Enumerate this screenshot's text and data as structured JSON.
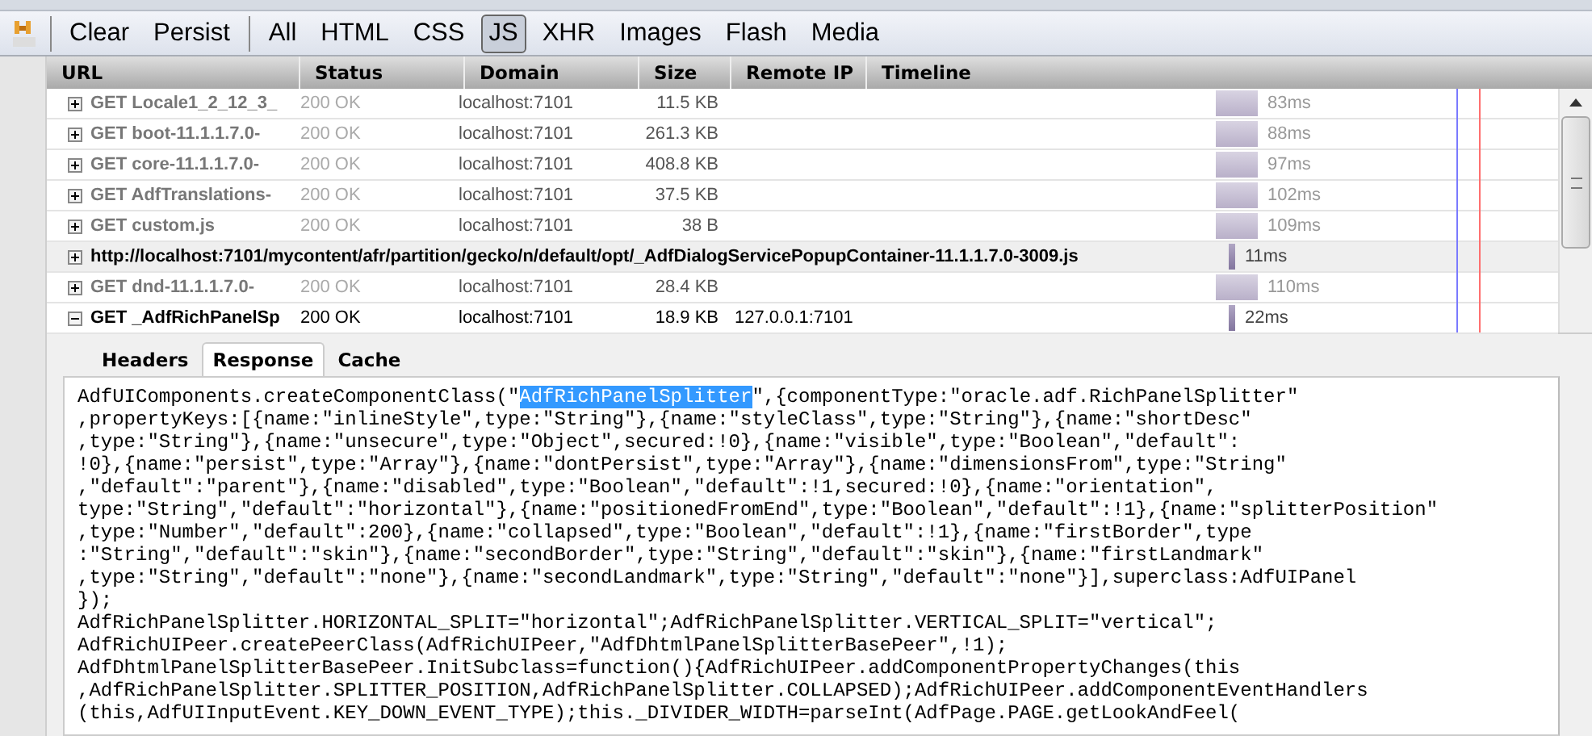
{
  "toolbar": {
    "actions": [
      "Clear",
      "Persist"
    ],
    "filters": [
      {
        "label": "All",
        "selected": false
      },
      {
        "label": "HTML",
        "selected": false
      },
      {
        "label": "CSS",
        "selected": false
      },
      {
        "label": "JS",
        "selected": true
      },
      {
        "label": "XHR",
        "selected": false
      },
      {
        "label": "Images",
        "selected": false
      },
      {
        "label": "Flash",
        "selected": false
      },
      {
        "label": "Media",
        "selected": false
      }
    ]
  },
  "table": {
    "columns": [
      "URL",
      "Status",
      "Domain",
      "Size",
      "Remote IP",
      "Timeline"
    ],
    "rows": [
      {
        "kind": "request",
        "expanded": false,
        "cached": true,
        "url": "GET Locale1_2_12_3_",
        "status": "200 OK",
        "domain": "localhost:7101",
        "size": "11.5 KB",
        "time": "83ms"
      },
      {
        "kind": "request",
        "expanded": false,
        "cached": true,
        "url": "GET boot-11.1.1.7.0-",
        "status": "200 OK",
        "domain": "localhost:7101",
        "size": "261.3 KB",
        "time": "88ms"
      },
      {
        "kind": "request",
        "expanded": false,
        "cached": true,
        "url": "GET core-11.1.1.7.0-",
        "status": "200 OK",
        "domain": "localhost:7101",
        "size": "408.8 KB",
        "time": "97ms"
      },
      {
        "kind": "request",
        "expanded": false,
        "cached": true,
        "url": "GET AdfTranslations-",
        "status": "200 OK",
        "domain": "localhost:7101",
        "size": "37.5 KB",
        "time": "102ms"
      },
      {
        "kind": "request",
        "expanded": false,
        "cached": true,
        "url": "GET custom.js",
        "status": "200 OK",
        "domain": "localhost:7101",
        "size": "38 B",
        "time": "109ms"
      },
      {
        "kind": "url",
        "expanded": false,
        "cached": false,
        "url": "http://localhost:7101/mycontent/afr/partition/gecko/n/default/opt/_AdfDialogServicePopupContainer-11.1.1.7.0-3009.js",
        "time": "11ms"
      },
      {
        "kind": "request",
        "expanded": false,
        "cached": true,
        "url": "GET dnd-11.1.1.7.0-",
        "status": "200 OK",
        "domain": "localhost:7101",
        "size": "28.4 KB",
        "time": "110ms"
      },
      {
        "kind": "request",
        "expanded": true,
        "cached": false,
        "url": "GET _AdfRichPanelSp",
        "status": "200 OK",
        "domain": "localhost:7101",
        "size": "18.9 KB",
        "remote_ip": "127.0.0.1:7101",
        "time": "22ms"
      }
    ]
  },
  "detail": {
    "tabs": [
      {
        "label": "Headers",
        "selected": false
      },
      {
        "label": "Response",
        "selected": true
      },
      {
        "label": "Cache",
        "selected": false
      }
    ],
    "lines": [
      {
        "segments": [
          {
            "text": "AdfUIComponents.createComponentClass(\"",
            "selected": false
          },
          {
            "text": "AdfRichPanelSplitter",
            "selected": true
          },
          {
            "text": "\",{componentType:\"oracle.adf.RichPanelSplitter\"",
            "selected": false
          }
        ]
      },
      {
        "segments": [
          {
            "text": ",propertyKeys:[{name:\"inlineStyle\",type:\"String\"},{name:\"styleClass\",type:\"String\"},{name:\"shortDesc\"",
            "selected": false
          }
        ]
      },
      {
        "segments": [
          {
            "text": ",type:\"String\"},{name:\"unsecure\",type:\"Object\",secured:!0},{name:\"visible\",type:\"Boolean\",\"default\":",
            "selected": false
          }
        ]
      },
      {
        "segments": [
          {
            "text": "!0},{name:\"persist\",type:\"Array\"},{name:\"dontPersist\",type:\"Array\"},{name:\"dimensionsFrom\",type:\"String\"",
            "selected": false
          }
        ]
      },
      {
        "segments": [
          {
            "text": ",\"default\":\"parent\"},{name:\"disabled\",type:\"Boolean\",\"default\":!1,secured:!0},{name:\"orientation\",",
            "selected": false
          }
        ]
      },
      {
        "segments": [
          {
            "text": "type:\"String\",\"default\":\"horizontal\"},{name:\"positionedFromEnd\",type:\"Boolean\",\"default\":!1},{name:\"splitterPosition\"",
            "selected": false
          }
        ]
      },
      {
        "segments": [
          {
            "text": ",type:\"Number\",\"default\":200},{name:\"collapsed\",type:\"Boolean\",\"default\":!1},{name:\"firstBorder\",type",
            "selected": false
          }
        ]
      },
      {
        "segments": [
          {
            "text": ":\"String\",\"default\":\"skin\"},{name:\"secondBorder\",type:\"String\",\"default\":\"skin\"},{name:\"firstLandmark\"",
            "selected": false
          }
        ]
      },
      {
        "segments": [
          {
            "text": ",type:\"String\",\"default\":\"none\"},{name:\"secondLandmark\",type:\"String\",\"default\":\"none\"}],superclass:AdfUIPanel",
            "selected": false
          }
        ]
      },
      {
        "segments": [
          {
            "text": "});",
            "selected": false
          }
        ]
      },
      {
        "segments": [
          {
            "text": "AdfRichPanelSplitter.HORIZONTAL_SPLIT=\"horizontal\";AdfRichPanelSplitter.VERTICAL_SPLIT=\"vertical\";",
            "selected": false
          }
        ]
      },
      {
        "segments": [
          {
            "text": "AdfRichUIPeer.createPeerClass(AdfRichUIPeer,\"AdfDhtmlPanelSplitterBasePeer\",!1);",
            "selected": false
          }
        ]
      },
      {
        "segments": [
          {
            "text": "AdfDhtmlPanelSplitterBasePeer.InitSubclass=function(){AdfRichUIPeer.addComponentPropertyChanges(this",
            "selected": false
          }
        ]
      },
      {
        "segments": [
          {
            "text": ",AdfRichPanelSplitter.SPLITTER_POSITION,AdfRichPanelSplitter.COLLAPSED);AdfRichUIPeer.addComponentEventHandlers",
            "selected": false
          }
        ]
      },
      {
        "segments": [
          {
            "text": "(this,AdfUIInputEvent.KEY_DOWN_EVENT_TYPE);this._DIVIDER_WIDTH=parseInt(AdfPage.PAGE.getLookAndFeel(",
            "selected": false
          }
        ]
      }
    ]
  }
}
